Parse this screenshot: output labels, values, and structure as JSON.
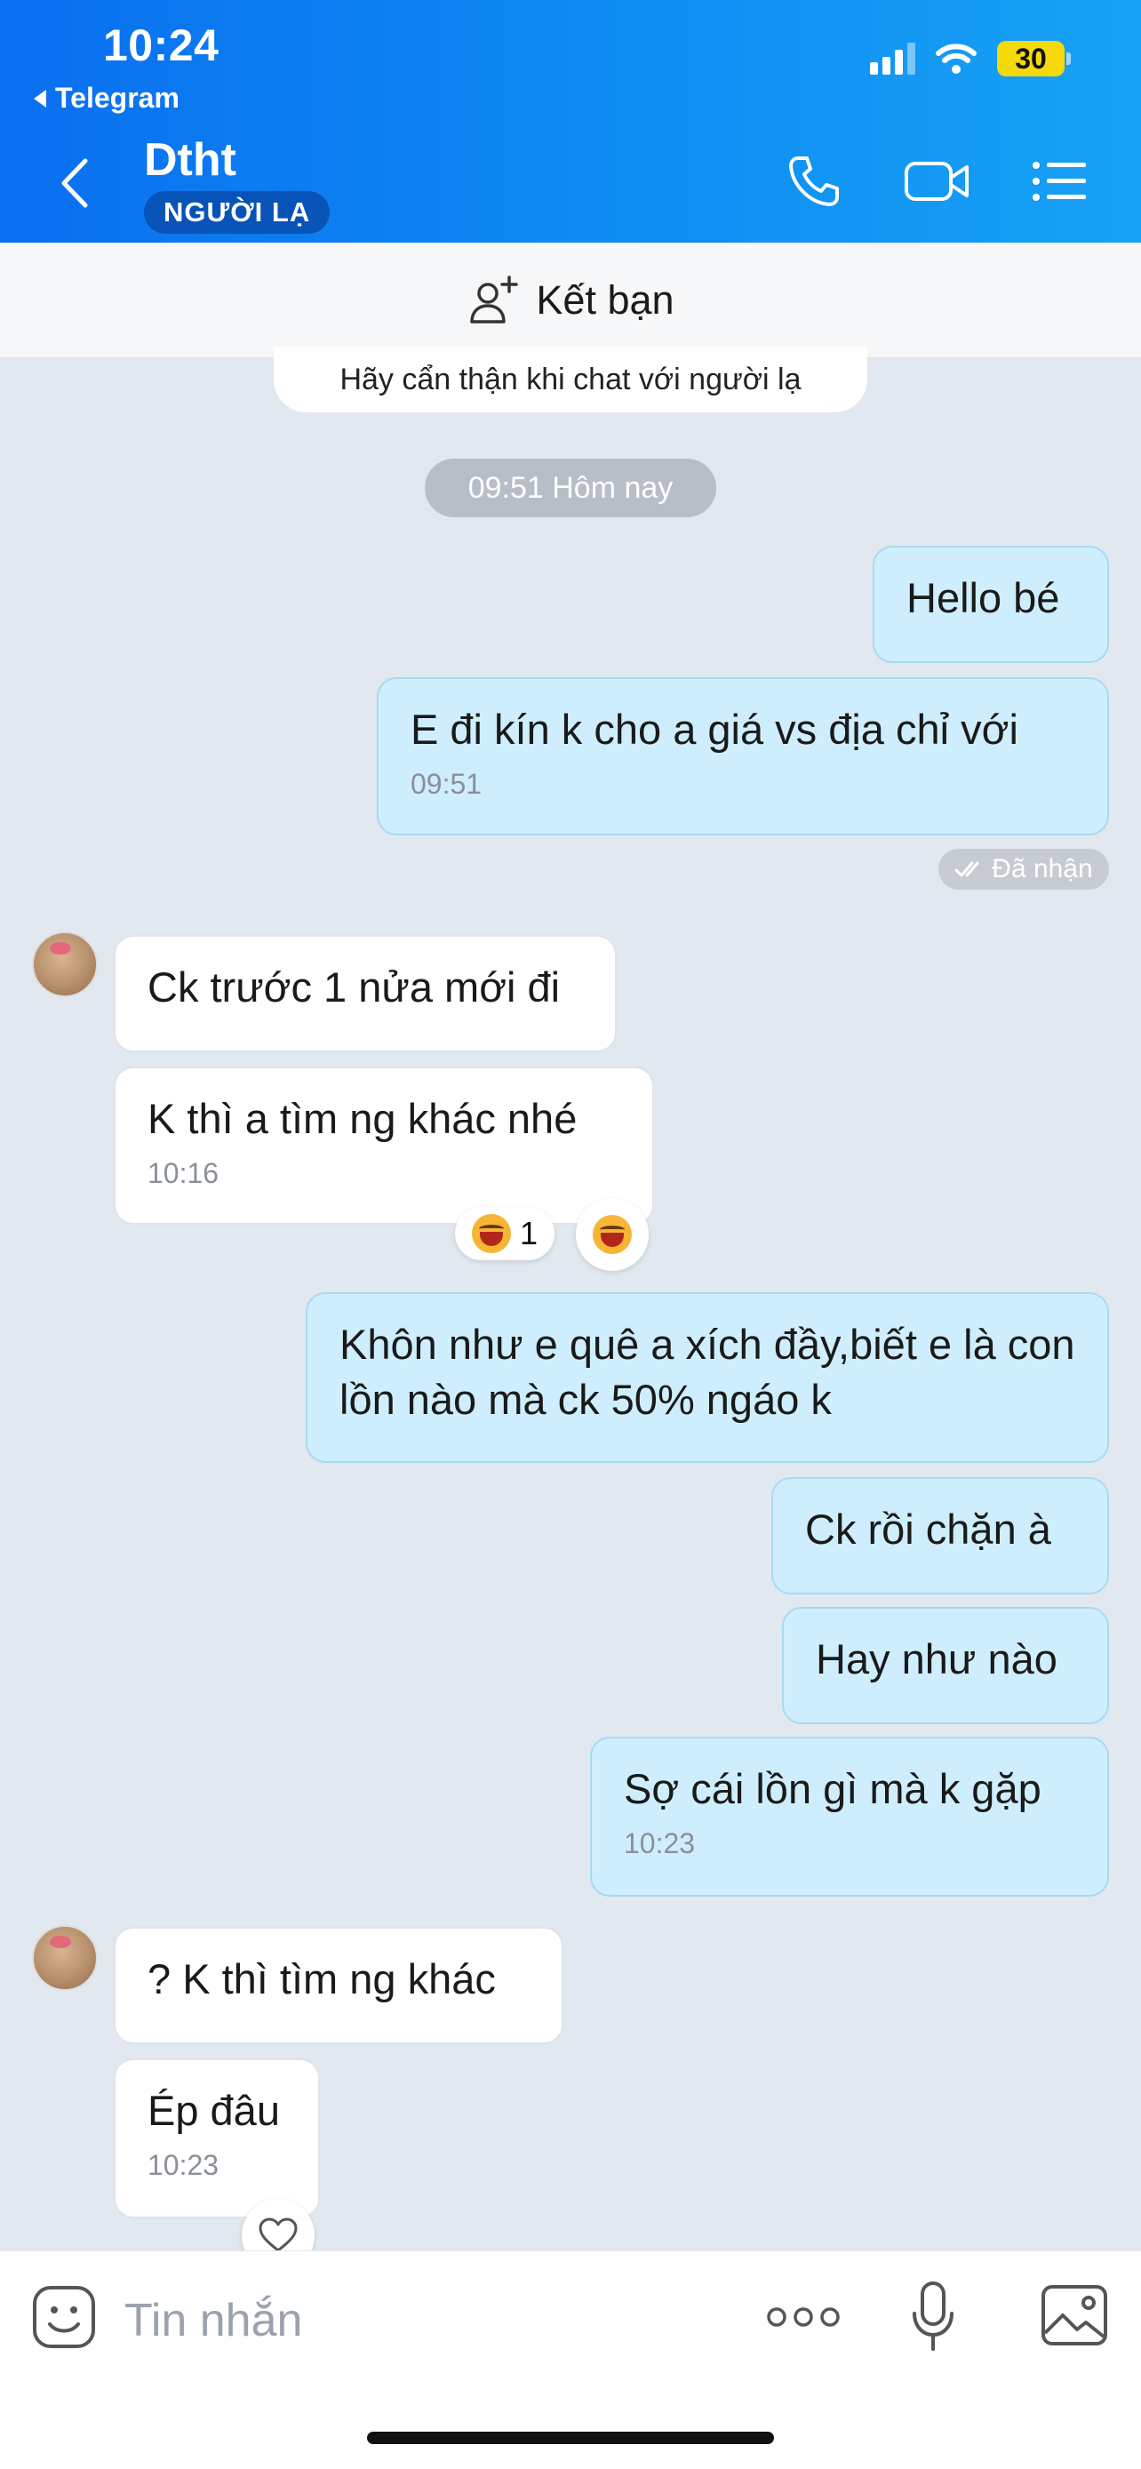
{
  "status_bar": {
    "time": "10:24",
    "back_app": "Telegram",
    "battery": "30"
  },
  "header": {
    "contact_name": "Dtht",
    "badge": "NGƯỜI LẠ"
  },
  "add_friend": {
    "label": "Kết bạn"
  },
  "notice": {
    "warning": "Hãy cẩn thận khi chat với người lạ",
    "date": "09:51 Hôm nay"
  },
  "messages": [
    {
      "dir": "out",
      "text": "Hello bé"
    },
    {
      "dir": "out",
      "text": "E đi kín k cho a giá vs địa chỉ với",
      "time": "09:51"
    },
    {
      "dir": "in",
      "text": "Ck trước 1 nửa mới đi"
    },
    {
      "dir": "in",
      "text": "K thì a tìm ng khác nhé",
      "time": "10:16"
    },
    {
      "dir": "out",
      "text": "Khôn như e quê a xích đầy,biết e là con lồn nào mà ck 50% ngáo k"
    },
    {
      "dir": "out",
      "text": "Ck rồi chặn à"
    },
    {
      "dir": "out",
      "text": "Hay như nào"
    },
    {
      "dir": "out",
      "text": "Sợ cái lồn gì mà k gặp",
      "time": "10:23"
    },
    {
      "dir": "in",
      "text": "? K thì tìm ng khác"
    },
    {
      "dir": "in",
      "text": "Ép đâu",
      "time": "10:23"
    }
  ],
  "received_status": "Đã nhận",
  "reaction": {
    "count": "1",
    "emoji": "laughing-crying"
  },
  "composer": {
    "placeholder": "Tin nhắn"
  },
  "colors": {
    "header_start": "#0a6ff0",
    "header_end": "#17a2f5",
    "outgoing_bubble": "#cfeefd",
    "incoming_bubble": "#ffffff",
    "chat_bg": "#e2e8ef"
  }
}
